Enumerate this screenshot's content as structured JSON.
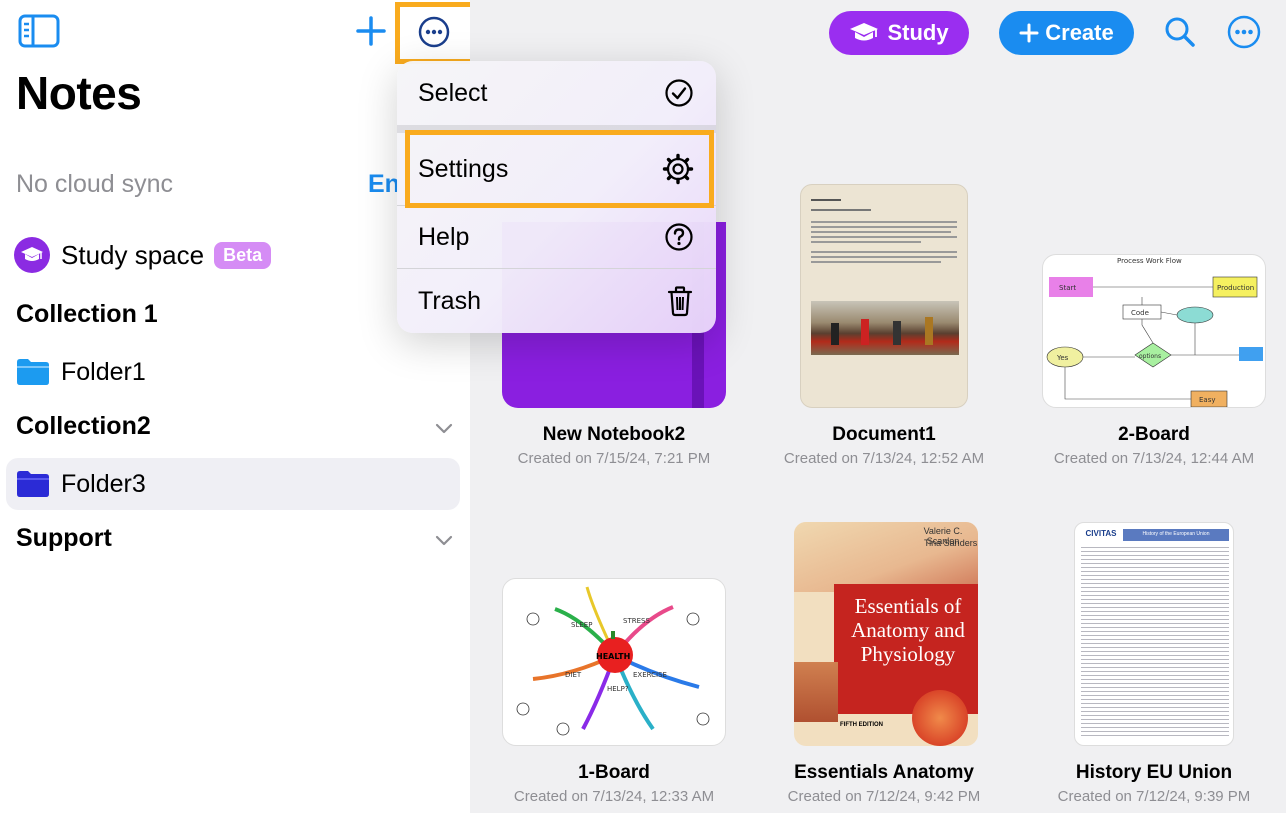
{
  "sidebar": {
    "title": "Notes",
    "cloud_status": "No cloud sync",
    "cloud_action": "En",
    "study_space": {
      "label": "Study space",
      "badge": "Beta"
    },
    "collections": [
      {
        "label": "Collection 1",
        "folders": [
          "Folder1"
        ]
      },
      {
        "label": "Collection2",
        "folders": [
          "Folder3"
        ]
      }
    ],
    "support_label": "Support"
  },
  "toolbar": {
    "study_label": "Study",
    "create_label": "Create"
  },
  "menu": {
    "items": [
      {
        "label": "Select",
        "icon": "checkmark-circle-icon"
      },
      {
        "label": "Settings",
        "icon": "gear-icon"
      },
      {
        "label": "Help",
        "icon": "question-circle-icon"
      },
      {
        "label": "Trash",
        "icon": "trash-icon"
      }
    ]
  },
  "notebooks": [
    {
      "title": "New Notebook2",
      "date": "Created on 7/15/24, 7:21 PM"
    },
    {
      "title": "Document1",
      "date": "Created on 7/13/24, 12:52 AM"
    },
    {
      "title": "2-Board",
      "date": "Created on 7/13/24, 12:44 AM"
    },
    {
      "title": "1-Board",
      "date": "Created on 7/13/24, 12:33 AM"
    },
    {
      "title": "Essentials Anatomy",
      "date": "Created on 7/12/24, 9:42 PM"
    },
    {
      "title": "History EU Union",
      "date": "Created on 7/12/24, 9:39 PM"
    }
  ],
  "thumb_text": {
    "process_title": "Process Work Flow",
    "flow_labels": [
      "Start",
      "Production",
      "Code",
      "Yes",
      "options",
      "Easy"
    ],
    "mindmap_center": "HEALTH",
    "mindmap_branches": [
      "SLEEP",
      "STRESS",
      "DIET",
      "EXERCISE",
      "HELP?"
    ],
    "book_authors": [
      "Valerie C. Scanlon",
      "Tina Sanders"
    ],
    "book_title": [
      "Essentials of",
      "Anatomy and",
      "Physiology"
    ],
    "book_edition": "FIFTH EDITION",
    "eu_brand": "CIVITAS",
    "eu_header": "History of the European Union"
  },
  "colors": {
    "accent_blue": "#1a8cf0",
    "study_purple": "#9a2ef0",
    "highlight_orange": "#f9ab1e",
    "notebook_purple": "#8a1fe0"
  }
}
